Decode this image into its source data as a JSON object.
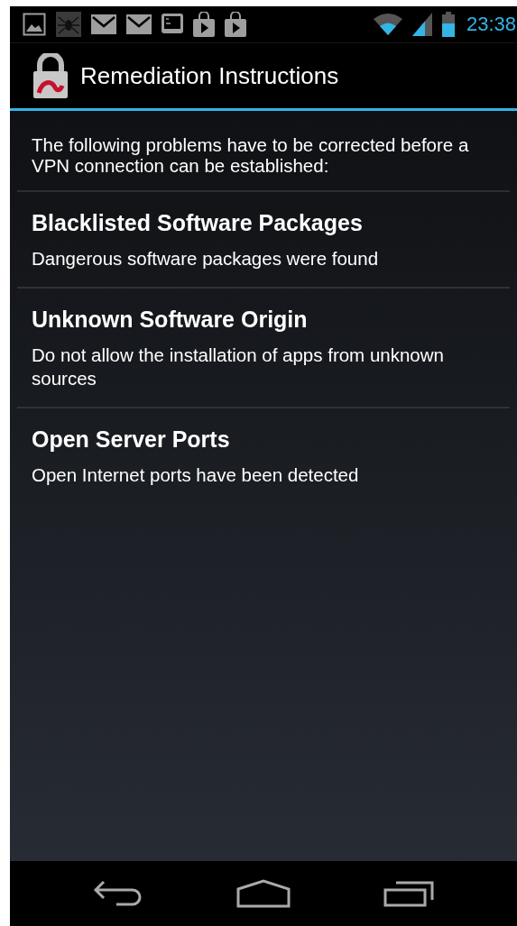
{
  "status_bar": {
    "time": "23:38"
  },
  "action_bar": {
    "title": "Remediation Instructions"
  },
  "intro": "The following problems have to be corrected before a VPN connection can be established:",
  "problems": [
    {
      "title": "Blacklisted Software Packages",
      "description": "Dangerous software packages were found"
    },
    {
      "title": "Unknown Software Origin",
      "description": "Do not allow the installation of apps from unknown sources"
    },
    {
      "title": "Open Server Ports",
      "description": "Open Internet ports have been detected"
    }
  ]
}
